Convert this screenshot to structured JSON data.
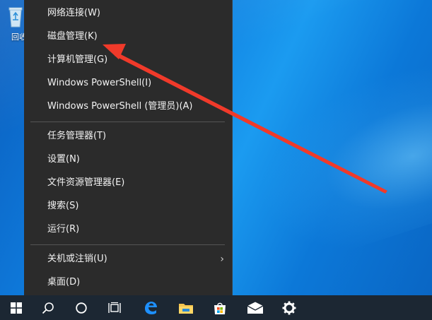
{
  "desktop": {
    "icon_label": "回收",
    "icon_name": "recycle-bin-icon"
  },
  "menu": {
    "items": [
      {
        "label": "网络连接(W)"
      },
      {
        "label": "磁盘管理(K)"
      },
      {
        "label": "计算机管理(G)"
      },
      {
        "label": "Windows PowerShell(I)"
      },
      {
        "label": "Windows PowerShell (管理员)(A)"
      },
      {
        "label": "任务管理器(T)"
      },
      {
        "label": "设置(N)"
      },
      {
        "label": "文件资源管理器(E)"
      },
      {
        "label": "搜索(S)"
      },
      {
        "label": "运行(R)"
      },
      {
        "label": "关机或注销(U)",
        "submenu_arrow": "›"
      },
      {
        "label": "桌面(D)"
      }
    ]
  },
  "annotation": {
    "color": "#f03a2a",
    "target": "磁盘管理(K)"
  },
  "taskbar": {
    "icons": [
      "windows-start-icon",
      "search-icon",
      "cortana-icon",
      "task-view-icon",
      "edge-icon",
      "file-explorer-icon",
      "store-icon",
      "mail-icon",
      "settings-gear-icon"
    ]
  },
  "colors": {
    "menu_bg": "#2b2b2b",
    "menu_text": "#f2f2f2",
    "taskbar_bg": "#1c2733",
    "desktop_blue": "#0f7fe0"
  }
}
